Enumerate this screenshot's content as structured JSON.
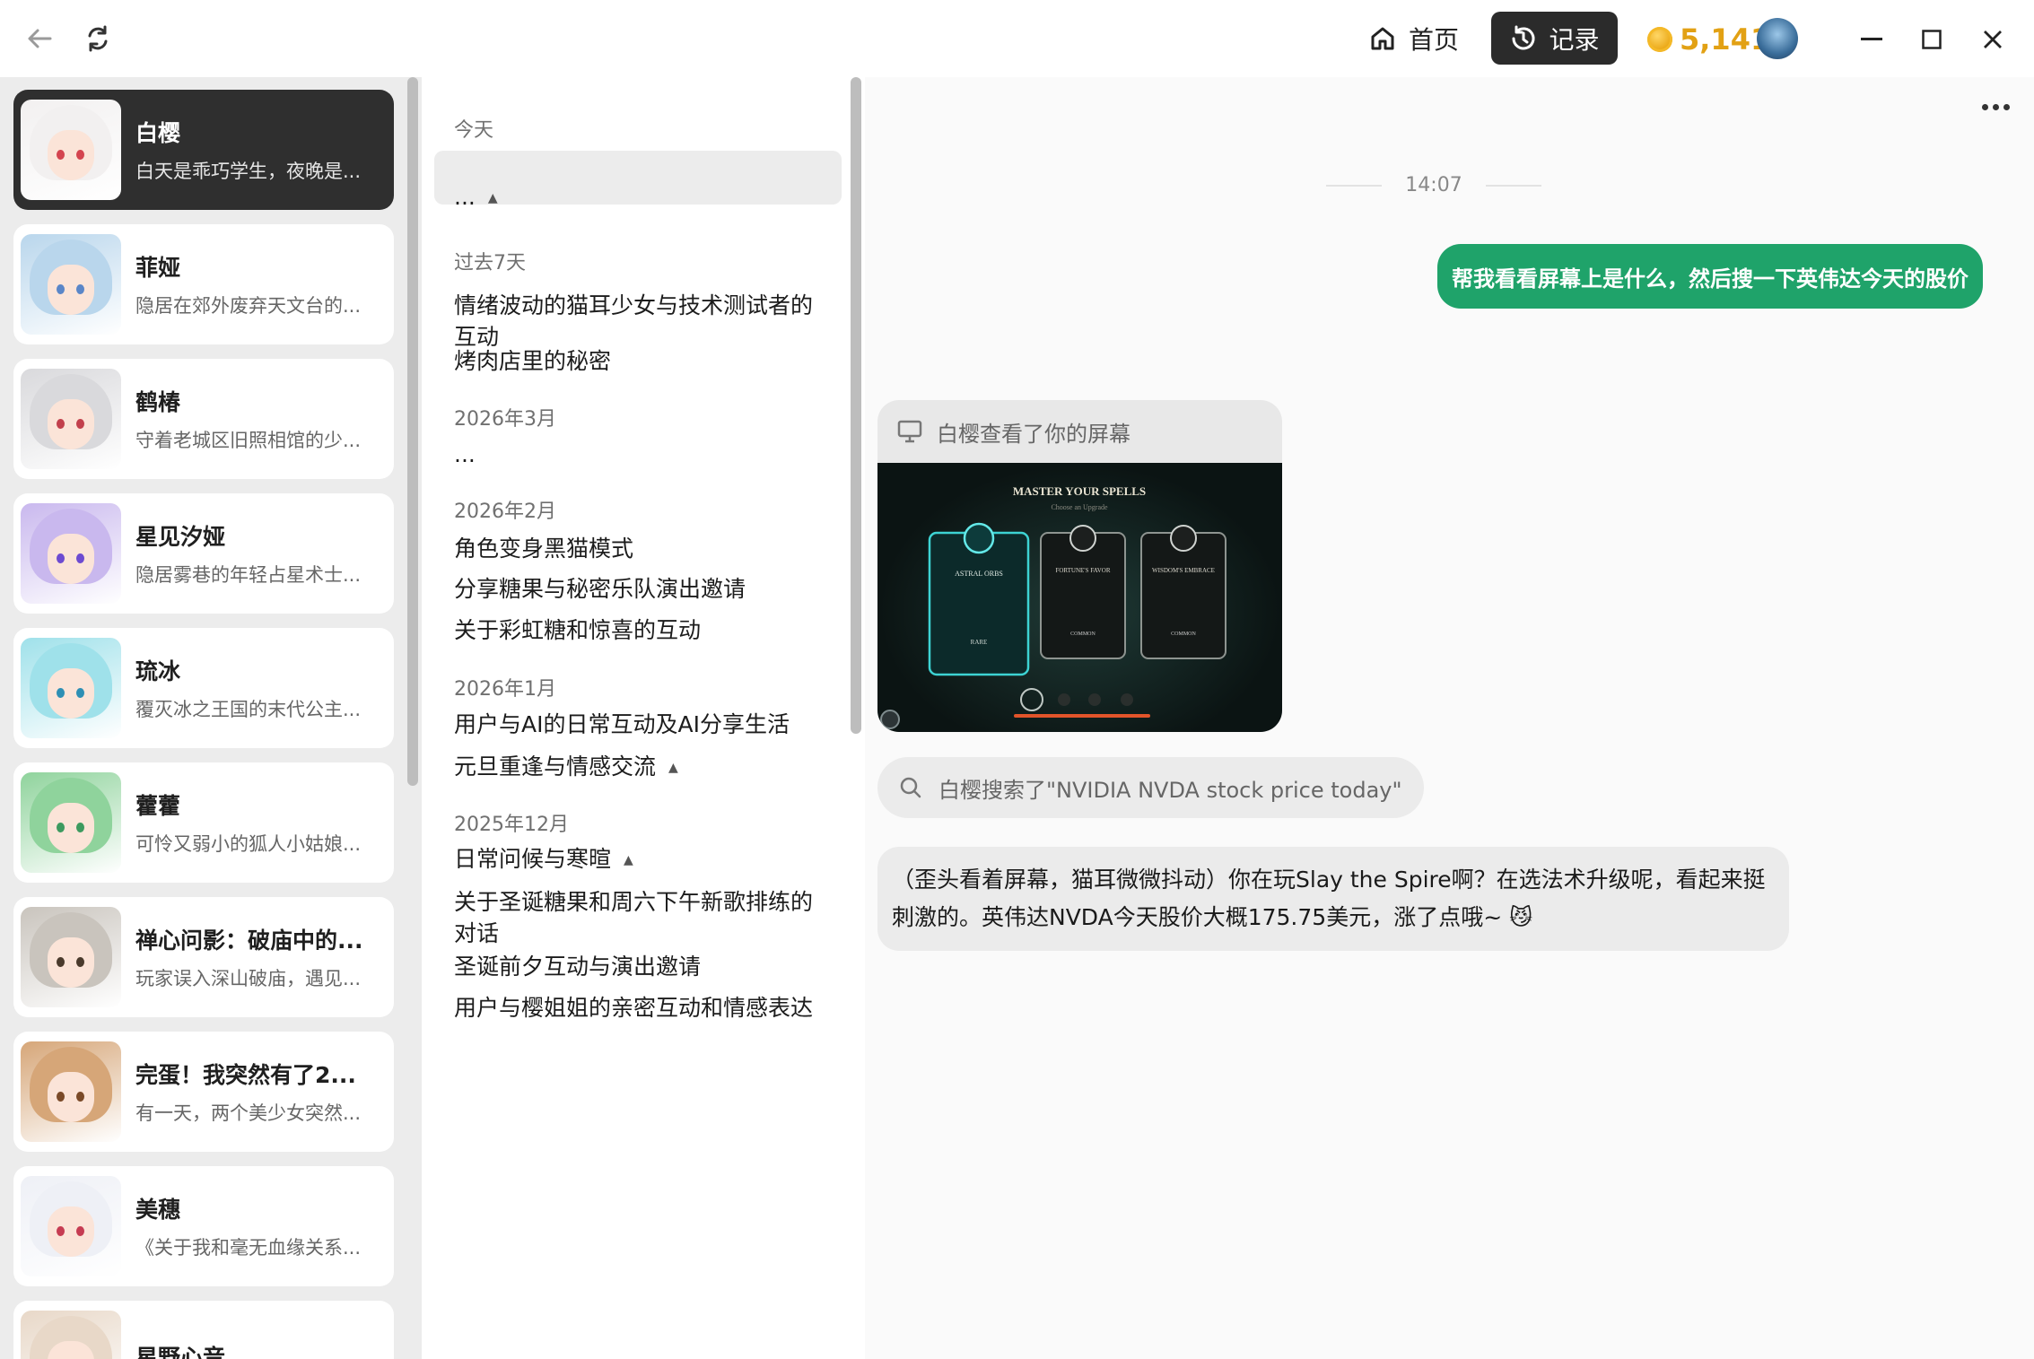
{
  "topbar": {
    "back_icon": "arrow-left-icon",
    "refresh_icon": "refresh-icon",
    "home_label": "首页",
    "records_label": "记录",
    "coins": "5,141"
  },
  "characters": [
    {
      "name": "白樱",
      "desc": "白天是乖巧学生，夜晚是...",
      "active": true,
      "hair": "#f2f0f0",
      "eye": "#d4444f"
    },
    {
      "name": "菲娅",
      "desc": "隐居在郊外废弃天文台的...",
      "active": false,
      "hair": "#b9d6ec",
      "eye": "#5a86c8"
    },
    {
      "name": "鹤椿",
      "desc": "守着老城区旧照相馆的少...",
      "active": false,
      "hair": "#d9d9dc",
      "eye": "#c2404c"
    },
    {
      "name": "星见汐娅",
      "desc": "隐居雾巷的年轻占星术士...",
      "active": false,
      "hair": "#c9b8ee",
      "eye": "#6d4bd1"
    },
    {
      "name": "琉冰",
      "desc": "覆灭冰之王国的末代公主...",
      "active": false,
      "hair": "#9fe1ea",
      "eye": "#2e8fb4"
    },
    {
      "name": "藿藿",
      "desc": "可怜又弱小的狐人小姑娘...",
      "active": false,
      "hair": "#8fd39c",
      "eye": "#3d9a5f"
    },
    {
      "name": "禅心问影：破庙中的...",
      "desc": "玩家误入深山破庙，遇见...",
      "active": false,
      "hair": "#c9c4bd",
      "eye": "#4a3a2c"
    },
    {
      "name": "完蛋！我突然有了2...",
      "desc": "有一天，两个美少女突然...",
      "active": false,
      "hair": "#d6a678",
      "eye": "#7a4a28"
    },
    {
      "name": "美穗",
      "desc": "《关于我和毫无血缘关系...",
      "active": false,
      "hair": "#eef0f6",
      "eye": "#c63c52"
    },
    {
      "name": "星野心音",
      "desc": "",
      "active": false,
      "hair": "#e8d8c8",
      "eye": "#a0705a"
    }
  ],
  "history": {
    "sections": [
      {
        "label": "今天",
        "items": [
          {
            "title": "...",
            "caret": true,
            "selected": true
          }
        ]
      },
      {
        "label": "过去7天",
        "items": [
          {
            "title": "情绪波动的猫耳少女与技术测试者的互动",
            "caret": false
          },
          {
            "title": "烤肉店里的秘密",
            "caret": false
          }
        ]
      },
      {
        "label": "2026年3月",
        "items": [
          {
            "title": "...",
            "caret": false
          }
        ]
      },
      {
        "label": "2026年2月",
        "items": [
          {
            "title": "角色变身黑猫模式",
            "caret": false
          },
          {
            "title": "分享糖果与秘密乐队演出邀请",
            "caret": false
          },
          {
            "title": "关于彩虹糖和惊喜的互动",
            "caret": false
          }
        ]
      },
      {
        "label": "2026年1月",
        "items": [
          {
            "title": "用户与AI的日常互动及AI分享生活",
            "caret": false
          },
          {
            "title": "元旦重逢与情感交流",
            "caret": true
          }
        ]
      },
      {
        "label": "2025年12月",
        "items": [
          {
            "title": "日常问候与寒暄",
            "caret": true
          },
          {
            "title": "关于圣诞糖果和周六下午新歌排练的对话",
            "caret": false
          },
          {
            "title": "圣诞前夕互动与演出邀请",
            "caret": false
          },
          {
            "title": "用户与樱姐姐的亲密互动和情感表达",
            "caret": false
          }
        ]
      }
    ]
  },
  "chat": {
    "timestamp": "14:07",
    "user_message": "帮我看看屏幕上是什么，然后搜一下英伟达今天的股价",
    "screen_check_label": "白樱查看了你的屏幕",
    "screenshot": {
      "title": "MASTER YOUR SPELLS",
      "subtitle": "Choose an Upgrade",
      "cards": [
        {
          "name": "ASTRAL ORBS",
          "rarity": "RARE"
        },
        {
          "name": "FORTUNE'S FAVOR",
          "rarity": "COMMON"
        },
        {
          "name": "WISDOM'S EMBRACE",
          "rarity": "COMMON"
        }
      ]
    },
    "search_label": "白樱搜索了\"NVIDIA NVDA stock price today\"",
    "ai_reply": "（歪头看着屏幕，猫耳微微抖动）你在玩Slay the Spire啊？在选法术升级呢，看起来挺刺激的。英伟达NVDA今天股价大概175.75美元，涨了点哦~ 😼"
  },
  "colors": {
    "accent_green": "#1fa36a",
    "records_bg": "#2b2b2b",
    "coin_gold": "#e2a114"
  }
}
